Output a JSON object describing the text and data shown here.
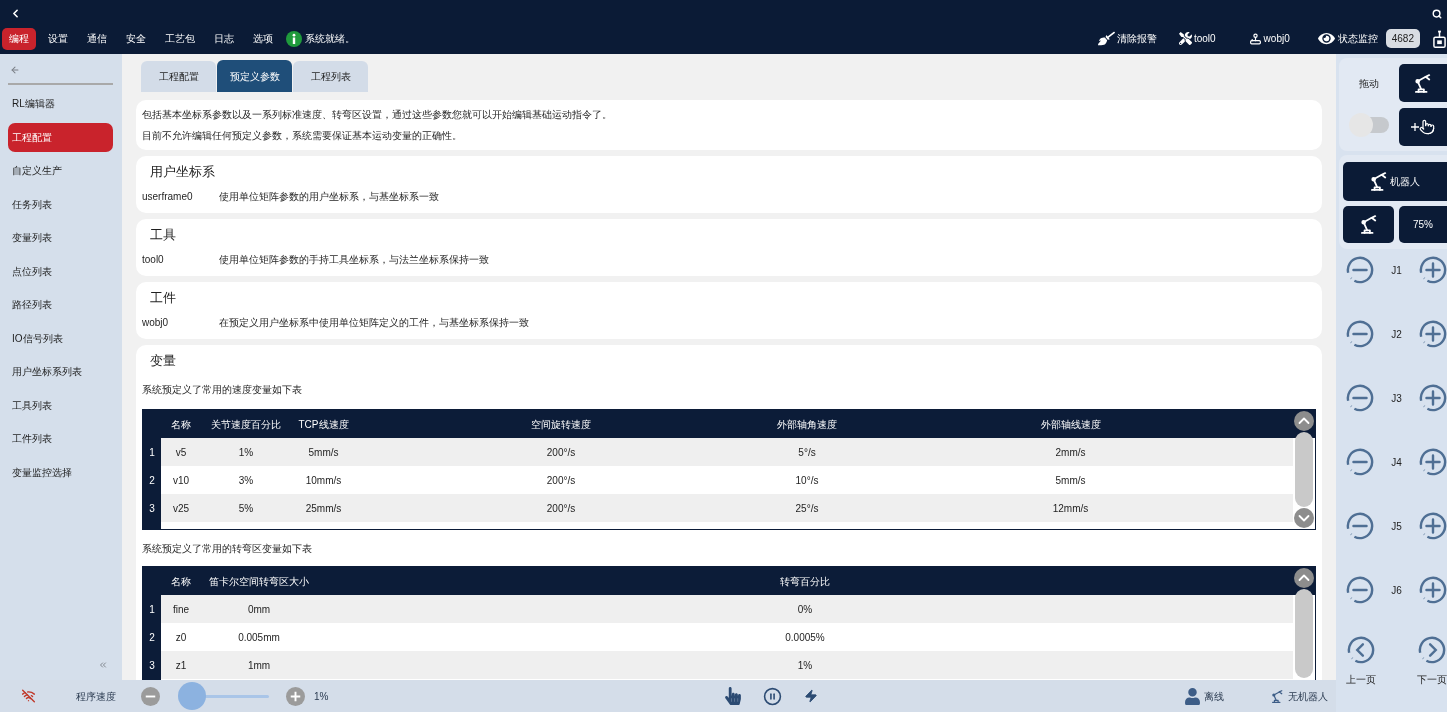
{
  "top_bar": {
    "menu": [
      {
        "label": "编程",
        "selected": true
      },
      {
        "label": "设置",
        "selected": false
      },
      {
        "label": "通信",
        "selected": false
      },
      {
        "label": "安全",
        "selected": false
      },
      {
        "label": "工艺包",
        "selected": false
      },
      {
        "label": "日志",
        "selected": false
      },
      {
        "label": "选项",
        "selected": false
      }
    ],
    "status": "系统就绪。",
    "clear_alarm": "清除报警",
    "tool": "tool0",
    "work_object": "wobj0",
    "monitor": "状态监控",
    "monitor_count": "4682"
  },
  "sidebar": {
    "items": [
      {
        "label": "RL编辑器",
        "selected": false
      },
      {
        "label": "工程配置",
        "selected": true
      },
      {
        "label": "自定义生产",
        "selected": false
      },
      {
        "label": "任务列表",
        "selected": false
      },
      {
        "label": "变量列表",
        "selected": false
      },
      {
        "label": "点位列表",
        "selected": false
      },
      {
        "label": "路径列表",
        "selected": false
      },
      {
        "label": "IO信号列表",
        "selected": false
      },
      {
        "label": "用户坐标系列表",
        "selected": false
      },
      {
        "label": "工具列表",
        "selected": false
      },
      {
        "label": "工件列表",
        "selected": false
      },
      {
        "label": "变量监控选择",
        "selected": false
      }
    ]
  },
  "tabs": [
    {
      "label": "工程配置",
      "selected": false
    },
    {
      "label": "预定义参数",
      "selected": true
    },
    {
      "label": "工程列表",
      "selected": false
    }
  ],
  "intro": [
    "包括基本坐标系参数以及一系列标准速度、转弯区设置，通过这些参数您就可以开始编辑基础运动指令了。",
    "目前不允许编辑任何预定义参数，系统需要保证基本运动变量的正确性。"
  ],
  "sections": [
    {
      "title": "用户坐标系",
      "name": "userframe0",
      "description": "使用单位矩阵参数的用户坐标系，与基坐标系一致"
    },
    {
      "title": "工具",
      "name": "tool0",
      "description": "使用单位矩阵参数的手持工具坐标系，与法兰坐标系保持一致"
    },
    {
      "title": "工件",
      "name": "wobj0",
      "description": "在预定义用户坐标系中使用单位矩阵定义的工件，与基坐标系保持一致"
    }
  ],
  "variables": {
    "title": "变量",
    "tables": [
      {
        "caption": "系统预定义了常用的速度变量如下表",
        "columns": [
          "名称",
          "关节速度百分比",
          "TCP线速度",
          "空间旋转速度",
          "外部轴角速度",
          "外部轴线速度"
        ],
        "rows": [
          {
            "number": "1",
            "cells": [
              "v5",
              "1%",
              "5mm/s",
              "200°/s",
              "5°/s",
              "2mm/s"
            ]
          },
          {
            "number": "2",
            "cells": [
              "v10",
              "3%",
              "10mm/s",
              "200°/s",
              "10°/s",
              "5mm/s"
            ]
          },
          {
            "number": "3",
            "cells": [
              "v25",
              "5%",
              "25mm/s",
              "200°/s",
              "25°/s",
              "12mm/s"
            ]
          }
        ]
      },
      {
        "caption": "系统预定义了常用的转弯区变量如下表",
        "columns": [
          "名称",
          "笛卡尔空间转弯区大小",
          "转弯百分比"
        ],
        "rows": [
          {
            "number": "1",
            "cells": [
              "fine",
              "0mm",
              "0%"
            ]
          },
          {
            "number": "2",
            "cells": [
              "z0",
              "0.005mm",
              "0.0005%"
            ]
          },
          {
            "number": "3",
            "cells": [
              "z1",
              "1mm",
              "1%"
            ]
          }
        ]
      }
    ]
  },
  "right_panel": {
    "drag": {
      "label": "拖动",
      "on": false
    },
    "robot_button": "机器人",
    "speed_button": "75%",
    "joints": [
      "J1",
      "J2",
      "J3",
      "J4",
      "J5",
      "J6"
    ],
    "previous": "上一页",
    "next": "下一页"
  },
  "bottom_bar": {
    "speed_label": "程序速度",
    "speed": {
      "level": 0.01
    },
    "speed_reading": "1%",
    "operator_status": "离线",
    "robot_status": "无机器人"
  }
}
